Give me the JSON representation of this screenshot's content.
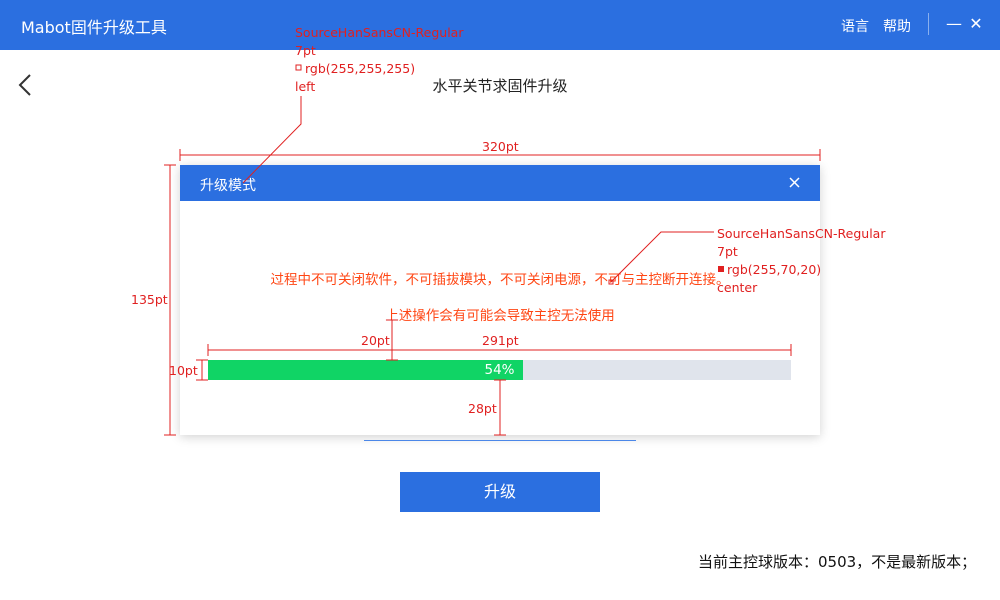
{
  "app": {
    "title": "Mabot固件升级工具",
    "language": "语言",
    "help": "帮助",
    "minimize": "—",
    "close": "✕"
  },
  "page": {
    "title": "水平关节求固件升级",
    "back_icon": "chevron-left-icon"
  },
  "dialog": {
    "title": "升级模式",
    "close_icon": "close-icon",
    "warning_line1": "过程中不可关闭软件，不可插拔模块，不可关闭电源，不可与主控断开连接。",
    "warning_line2": "上述操作会有可能会导致主控无法使用",
    "progress": {
      "value": 0.54,
      "label": "54%"
    }
  },
  "upgrade_button": "升级",
  "version_text": "当前主控球版本：0503，不是最新版本；",
  "annotations": {
    "title_spec": [
      "SourceHanSansCN-Regular",
      "7pt",
      "rgb(255,255,255)",
      "left"
    ],
    "warning_spec": [
      "SourceHanSansCN-Regular",
      "7pt",
      "rgb(255,70,20)",
      "center"
    ],
    "dialog_width": "320pt",
    "dialog_height": "135pt",
    "progress_offset": "20pt",
    "progress_width": "291pt",
    "progress_height": "10pt",
    "bottom_gap": "28pt"
  },
  "colors": {
    "primary": "#2b6fe0",
    "warning": "#ff4614",
    "progress_fill": "#10d465",
    "progress_track": "#e0e4ec",
    "annotation": "#e02020"
  }
}
